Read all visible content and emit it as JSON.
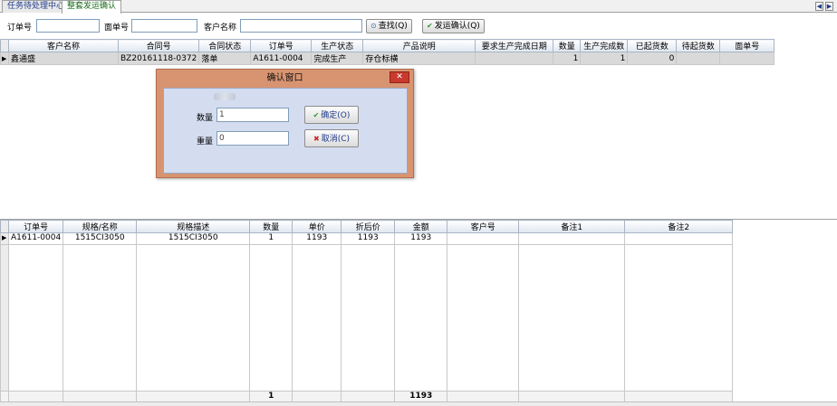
{
  "tabs": [
    {
      "label": "任务待处理中心",
      "active": false
    },
    {
      "label": "整套发运确认",
      "active": true
    }
  ],
  "toolbar": {
    "order_label": "订单号",
    "order_value": "",
    "face_label": "面单号",
    "face_value": "",
    "customer_label": "客户名称",
    "customer_value": "",
    "search_label": "查找(Q)",
    "confirm_label": "发运确认(Q)"
  },
  "top_grid": {
    "columns": [
      "客户名称",
      "合同号",
      "合同状态",
      "订单号",
      "生产状态",
      "产品说明",
      "要求生产完成日期",
      "数量",
      "生产完成数",
      "已起货数",
      "待起货数",
      "面单号"
    ],
    "rows": [
      [
        "鑫通盛",
        "BZ20161118-0372",
        "落单",
        "A1611-0004",
        "完成生产",
        "存仓标横",
        "",
        "1",
        "1",
        "0",
        "",
        ""
      ]
    ]
  },
  "bottom_grid": {
    "columns": [
      "订单号",
      "规格/名称",
      "规格描述",
      "数量",
      "单价",
      "折后价",
      "金额",
      "客户号",
      "备注1",
      "备注2"
    ],
    "rows": [
      [
        "A1611-0004",
        "1515CI3050",
        "1515CI3050",
        "1",
        "1193",
        "1193",
        "1193",
        "",
        "",
        ""
      ]
    ],
    "totals": {
      "qty": "1",
      "amount": "1193"
    }
  },
  "dialog": {
    "title": "确认窗口",
    "close_label": "✕",
    "qty_label": "数量",
    "qty_value": "1",
    "weight_label": "重量",
    "weight_value": "0",
    "ok_label": "确定(O)",
    "cancel_label": "取消(C)"
  },
  "icons": {
    "search": "magnifier-icon",
    "confirm": "check-icon",
    "cancel": "x-icon",
    "nav_prev": "arrow-left-icon",
    "nav_next": "arrow-right-icon",
    "row_indicator": "triangle-right-icon"
  },
  "colors": {
    "dialog_frame": "#d89470",
    "dialog_body": "#d4dcf0",
    "close_button": "#c93a2e",
    "active_tab_text": "#1a6b1a"
  }
}
